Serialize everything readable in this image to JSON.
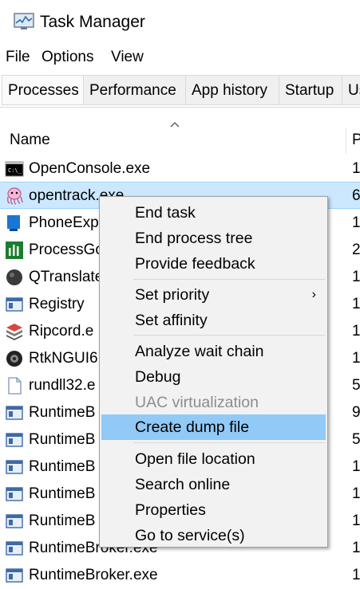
{
  "window": {
    "title": "Task Manager"
  },
  "menubar": [
    "File",
    "Options",
    "View"
  ],
  "tabs": [
    "Processes",
    "Performance",
    "App history",
    "Startup",
    "Us"
  ],
  "columns": {
    "name": "Name",
    "second": "P"
  },
  "processes": [
    {
      "name": "OpenConsole.exe",
      "value": "1",
      "icon": "console-icon"
    },
    {
      "name": "opentrack.exe",
      "value": "6",
      "icon": "octopus-icon"
    },
    {
      "name": "PhoneExp",
      "value": "1",
      "icon": "phone-icon"
    },
    {
      "name": "ProcessGo",
      "value": "2",
      "icon": "bars-icon"
    },
    {
      "name": "QTranslate",
      "value": "1",
      "icon": "dark-circle-icon"
    },
    {
      "name": "Registry",
      "value": "1",
      "icon": "window-icon"
    },
    {
      "name": "Ripcord.e",
      "value": "1",
      "icon": "stack-icon"
    },
    {
      "name": "RtkNGUI6",
      "value": "1",
      "icon": "speaker-icon"
    },
    {
      "name": "rundll32.e",
      "value": "5",
      "icon": "file-icon"
    },
    {
      "name": "RuntimeB",
      "value": "9",
      "icon": "window-icon"
    },
    {
      "name": "RuntimeB",
      "value": "5",
      "icon": "window-icon"
    },
    {
      "name": "RuntimeB",
      "value": "1",
      "icon": "window-icon"
    },
    {
      "name": "RuntimeB",
      "value": "1",
      "icon": "window-icon"
    },
    {
      "name": "RuntimeB",
      "value": "1",
      "icon": "window-icon"
    },
    {
      "name": "RuntimeBroker.exe",
      "value": "1",
      "icon": "window-icon"
    },
    {
      "name": "RuntimeBroker.exe",
      "value": "1",
      "icon": "window-icon"
    }
  ],
  "context_menu": {
    "end_task": "End task",
    "end_process_tree": "End process tree",
    "provide_feedback": "Provide feedback",
    "set_priority": "Set priority",
    "set_affinity": "Set affinity",
    "analyze_wait_chain": "Analyze wait chain",
    "debug": "Debug",
    "uac_virtualization": "UAC virtualization",
    "create_dump_file": "Create dump file",
    "open_file_location": "Open file location",
    "search_online": "Search online",
    "properties": "Properties",
    "go_to_services": "Go to service(s)",
    "submenu_arrow": "›"
  },
  "colors": {
    "selection": "#cce8ff",
    "menu_hover": "#91c9f7",
    "menu_bg": "#f2f2f2"
  }
}
